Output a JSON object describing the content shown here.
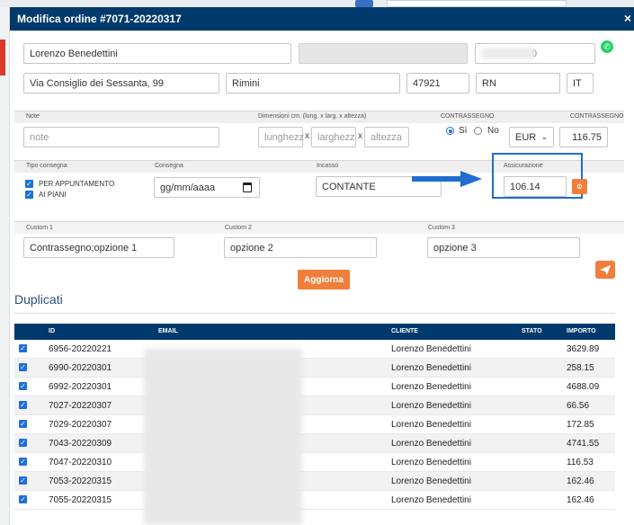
{
  "modal": {
    "title": "Modifica ordine #7071-20220317",
    "close": "×"
  },
  "customer": {
    "name": "Lorenzo Benedettini",
    "phone_tail": "0",
    "address": "Via Consiglio dei Sessanta, 99",
    "city": "Rimini",
    "zip": "47921",
    "province": "RN",
    "country": "IT"
  },
  "labels": {
    "note": "Note",
    "dimensions": "Dimensioni cm. (lung. x larg. x altezza)",
    "contrassegno_left": "CONTRASSEGNO",
    "contrassegno_right": "CONTRASSEGNO",
    "tipo_consegna": "Tipo consegna",
    "consegna": "Consegna",
    "incasso": "Incasso",
    "assicurazione": "Assicurazione",
    "custom1": "Custom 1",
    "custom2": "Custom 2",
    "custom3": "Custom 3"
  },
  "fields": {
    "note_placeholder": "note",
    "lunghezza_placeholder": "lunghezz",
    "larghezza_placeholder": "larghezz",
    "altezza_placeholder": "altezza",
    "x": "x",
    "radio_si": "Sì",
    "radio_no": "No",
    "currency": "EUR",
    "contrassegno_amount": "116.75",
    "opt_appuntamento": "PER APPUNTAMENTO",
    "opt_piani": "AI PIANI",
    "date_placeholder": "gg/mm/aaaa",
    "incasso_value": "CONTANTE",
    "assicurazione_value": "106.14",
    "custom1_value": "Contrassegno;opzione 1",
    "custom2_value": "opzione 2",
    "custom3_value": "opzione 3"
  },
  "buttons": {
    "aggiorna": "Aggiorna"
  },
  "duplicati": {
    "title": "Duplicati",
    "columns": {
      "id": "ID",
      "email": "EMAIL",
      "cliente": "CLIENTE",
      "stato": "STATO",
      "importo": "IMPORTO"
    },
    "rows": [
      {
        "id": "6956-20220221",
        "cliente": "Lorenzo Benedettini",
        "importo": "3629.89"
      },
      {
        "id": "6990-20220301",
        "cliente": "Lorenzo Benedettini",
        "importo": "258.15"
      },
      {
        "id": "6992-20220301",
        "cliente": "Lorenzo Benedettini",
        "importo": "4688.09"
      },
      {
        "id": "7027-20220307",
        "cliente": "Lorenzo Benedettini",
        "importo": "66.56"
      },
      {
        "id": "7029-20220307",
        "cliente": "Lorenzo Benedettini",
        "importo": "172.85"
      },
      {
        "id": "7043-20220309",
        "cliente": "Lorenzo Benedettini",
        "importo": "4741.55"
      },
      {
        "id": "7047-20220310",
        "cliente": "Lorenzo Benedettini",
        "importo": "116.53"
      },
      {
        "id": "7053-20220315",
        "cliente": "Lorenzo Benedettini",
        "importo": "162.46"
      },
      {
        "id": "7055-20220315",
        "cliente": "Lorenzo Benedettini",
        "importo": "162.46"
      }
    ]
  }
}
